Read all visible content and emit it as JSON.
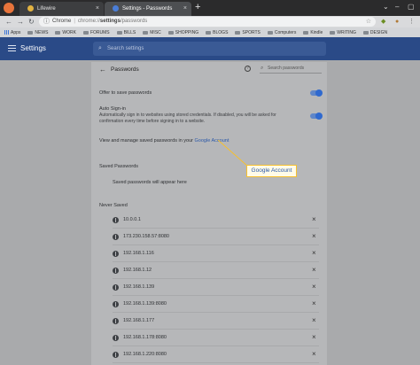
{
  "browser": {
    "tabs": [
      {
        "title": "Lifewire",
        "favicon_color": "#e3b341"
      },
      {
        "title": "Settings - Passwords",
        "favicon_color": "#4a7ed8"
      }
    ],
    "new_tab_glyph": "+",
    "close_glyph": "×",
    "window_controls": [
      "⌄",
      "–",
      "▢"
    ],
    "url": {
      "origin": "Chrome",
      "separator": "|",
      "scheme": "chrome://",
      "host": "settings",
      "path": "/passwords"
    },
    "bookmarks": [
      "Apps",
      "NEWS",
      "WORK",
      "FORUMS",
      "BILLS",
      "MISC",
      "SHOPPING",
      "BLOGS",
      "SPORTS",
      "Computers",
      "Kindle",
      "WRITING",
      "DESIGN"
    ]
  },
  "settings": {
    "header_title": "Settings",
    "search_placeholder": "Search settings"
  },
  "passwords": {
    "title": "Passwords",
    "search_placeholder": "Search passwords",
    "offer_to_save": {
      "label": "Offer to save passwords",
      "enabled": true
    },
    "auto_signin": {
      "label": "Auto Sign-in",
      "desc_line1": "Automatically sign in to websites using stored credentials. If disabled, you will be asked for",
      "desc_line2": "confirmation every time before signing in to a website.",
      "enabled": true
    },
    "manage_text": "View and manage saved passwords in your",
    "manage_link": "Google Account",
    "saved_heading": "Saved Passwords",
    "saved_empty": "Saved passwords will appear here",
    "never_heading": "Never Saved",
    "never_saved": [
      "10.0.0.1",
      "173.230.158.57:8080",
      "192.168.1.116",
      "192.168.1.12",
      "192.168.1.139",
      "192.168.1.139:8080",
      "192.168.1.177",
      "192.168.1.178:8080",
      "192.168.1.220:8080"
    ]
  },
  "callout": {
    "label": "Google Account",
    "border_color": "#f6c02f"
  },
  "colors": {
    "accent": "#2a4a87",
    "toggle": "#2f69cf",
    "link": "#2b58a8"
  }
}
